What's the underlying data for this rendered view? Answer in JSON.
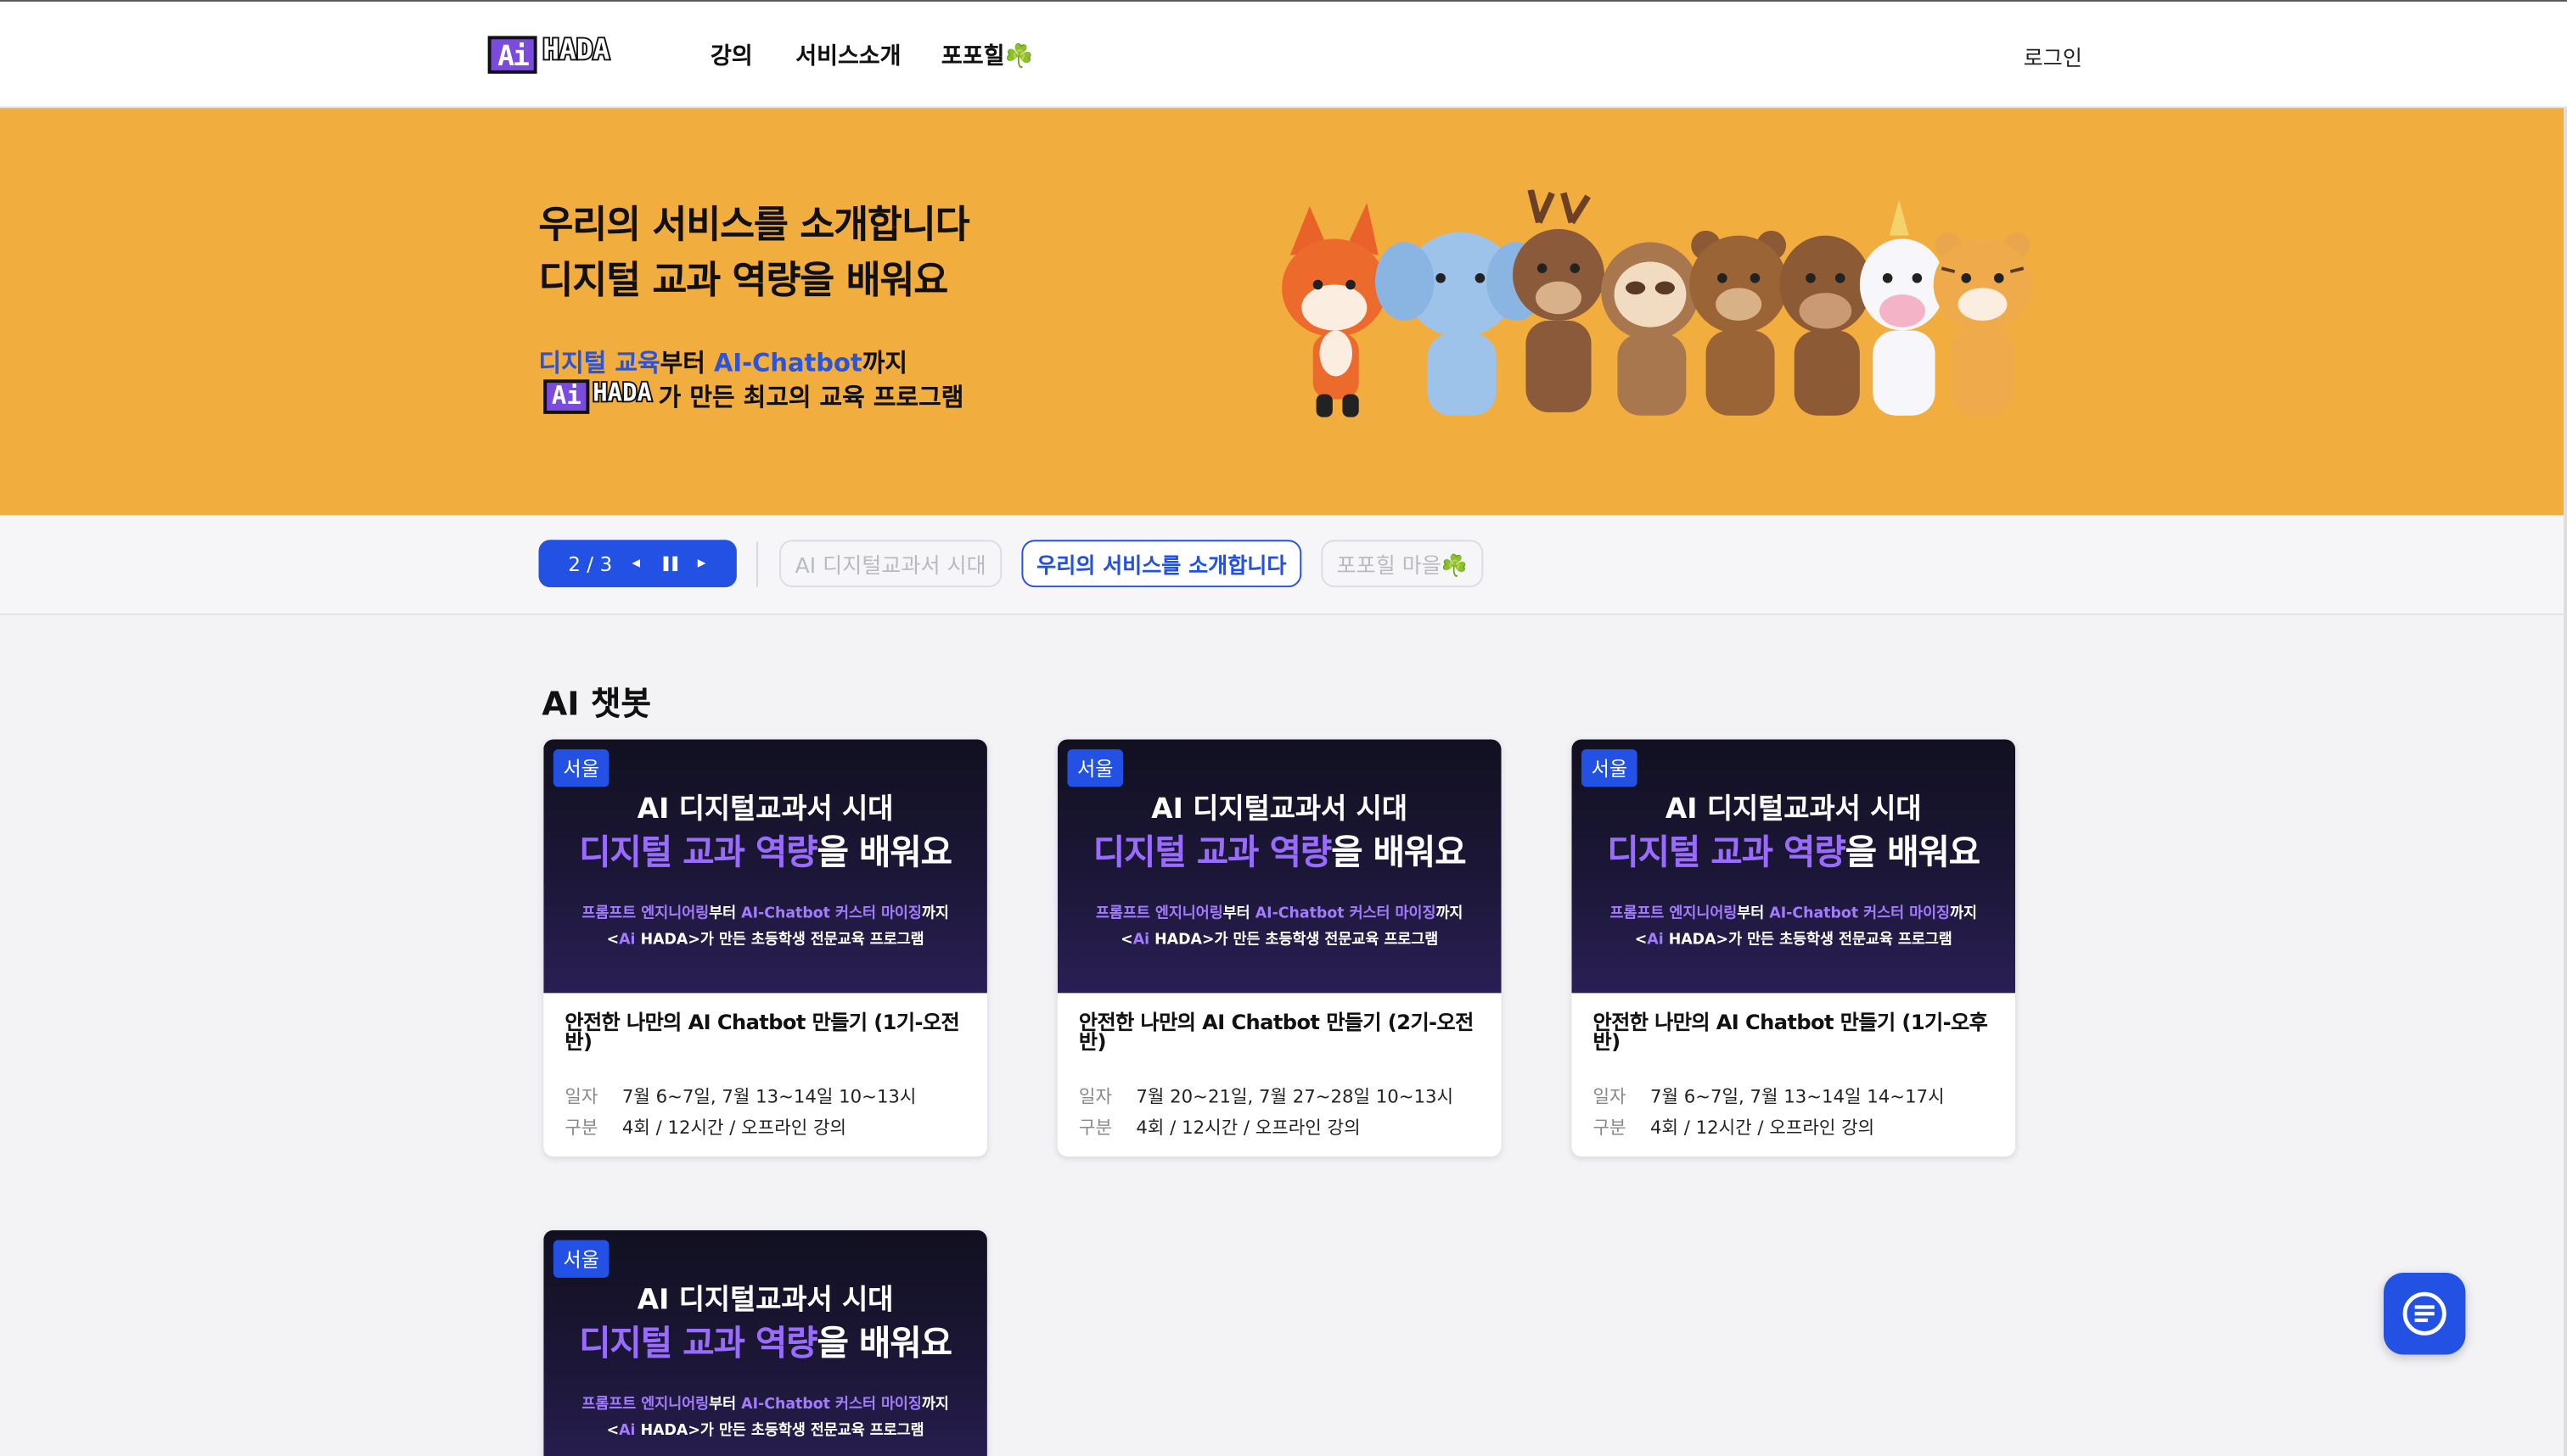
{
  "header": {
    "logo_ai": "Ai",
    "logo_hada": "HADA",
    "nav": [
      "강의",
      "서비스소개",
      "포포힐☘️"
    ],
    "login": "로그인"
  },
  "banner": {
    "title_line1": "우리의 서비스를 소개합니다",
    "title_line2": "디지털 교과 역량을 배워요",
    "sub_blue1": "디지털 교육",
    "sub_mid1": "부터 ",
    "sub_blue2": "AI-Chatbot",
    "sub_end1": "까지",
    "sub_line2": "가 만든 최고의 교육 프로그램",
    "logo_ai": "Ai",
    "logo_hada": "HADA",
    "background": "#f2ad3f"
  },
  "tabs": {
    "pager_text": "2 / 3",
    "prev_icon": "◂",
    "pause_icon": "❚❚",
    "next_icon": "▸",
    "items": [
      "AI 디지털교과서 시대",
      "우리의 서비스를 소개합니다",
      "포포힐 마을☘️"
    ],
    "active_index": 1
  },
  "section": {
    "title": "AI 챗봇"
  },
  "card_thumb": {
    "badge": "서울",
    "line1": "AI 디지털교과서 시대",
    "line2_purple": "디지털 교과 역량",
    "line2_rest": "을 배워요",
    "line3_purple1": "프롬프트 엔지니어링",
    "line3_mid": "부터 ",
    "line3_purple2": "AI-Chatbot 커스터 마이징",
    "line3_end": "까지",
    "line4_pre": "<",
    "line4_ai": "Ai",
    "line4_hada": " HADA",
    "line4_post": ">가 만든 초등학생 전문교육 프로그램"
  },
  "cards": [
    {
      "title": "안전한 나만의 AI Chatbot 만들기 (1기-오전반)",
      "date_label": "일자",
      "date": "7월 6~7일, 7월 13~14일 10~13시",
      "type_label": "구분",
      "type": "4회 / 12시간 / 오프라인 강의"
    },
    {
      "title": "안전한 나만의 AI Chatbot 만들기 (2기-오전반)",
      "date_label": "일자",
      "date": "7월 20~21일, 7월 27~28일 10~13시",
      "type_label": "구분",
      "type": "4회 / 12시간 / 오프라인 강의"
    },
    {
      "title": "안전한 나만의 AI Chatbot 만들기 (1기-오후반)",
      "date_label": "일자",
      "date": "7월 6~7일, 7월 13~14일 14~17시",
      "type_label": "구분",
      "type": "4회 / 12시간 / 오프라인 강의"
    }
  ],
  "colors": {
    "primary": "#2251e4",
    "purple": "#7b4be0"
  }
}
